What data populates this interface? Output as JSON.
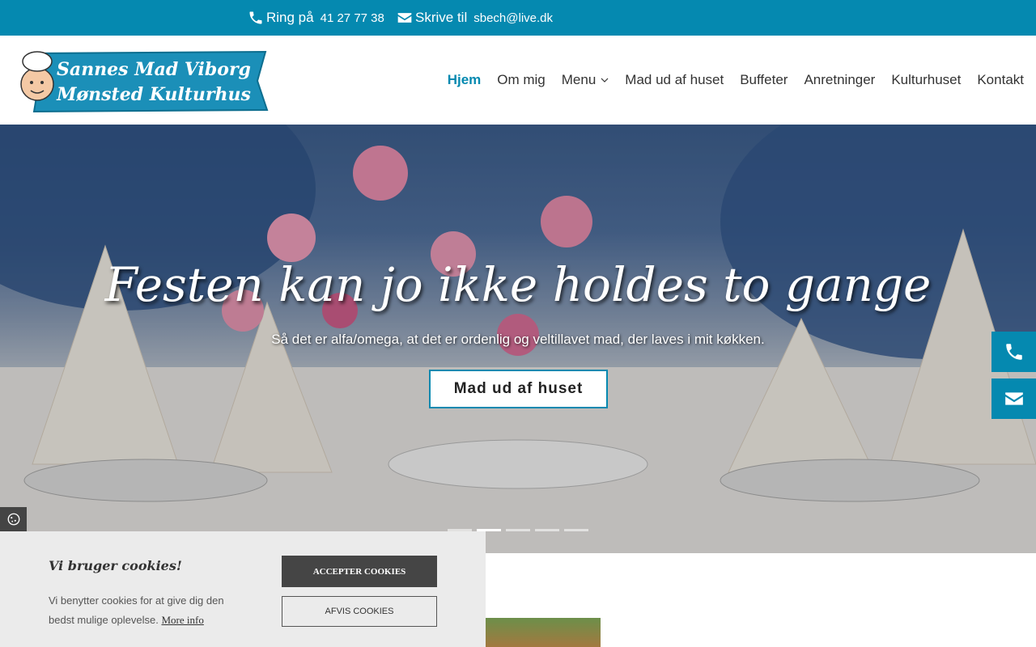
{
  "topbar": {
    "phone_label": "Ring på",
    "phone_number": "41 27 77 38",
    "mail_label": "Skrive til",
    "mail_address": "sbech@live.dk",
    "bg_color": "#0589b0"
  },
  "logo": {
    "line1": "Sannes Mad Viborg",
    "line2": "Mønsted Kulturhus"
  },
  "nav": {
    "items": [
      {
        "label": "Hjem",
        "active": true
      },
      {
        "label": "Om mig"
      },
      {
        "label": "Menu",
        "has_dropdown": true
      },
      {
        "label": "Mad ud af huset"
      },
      {
        "label": "Buffeter"
      },
      {
        "label": "Anretninger"
      },
      {
        "label": "Kulturhuset"
      },
      {
        "label": "Kontakt"
      }
    ]
  },
  "hero": {
    "title": "Festen kan jo ikke holdes to gange",
    "subtitle": "Så det er alfa/omega, at det er ordenlig og veltillavet mad, der laves i mit køkken.",
    "button_label": "Mad ud af huset",
    "slides_count": 5,
    "active_slide": 2
  },
  "side_buttons": {
    "icons": [
      "phone-icon",
      "envelope-icon"
    ]
  },
  "cookie": {
    "title": "Vi bruger cookies!",
    "text": "Vi benytter cookies for at give dig den bedst mulige oplevelse.",
    "more_info": "More info",
    "accept_label": "ACCEPTER COOKIES",
    "decline_label": "AFVIS COOKIES"
  }
}
